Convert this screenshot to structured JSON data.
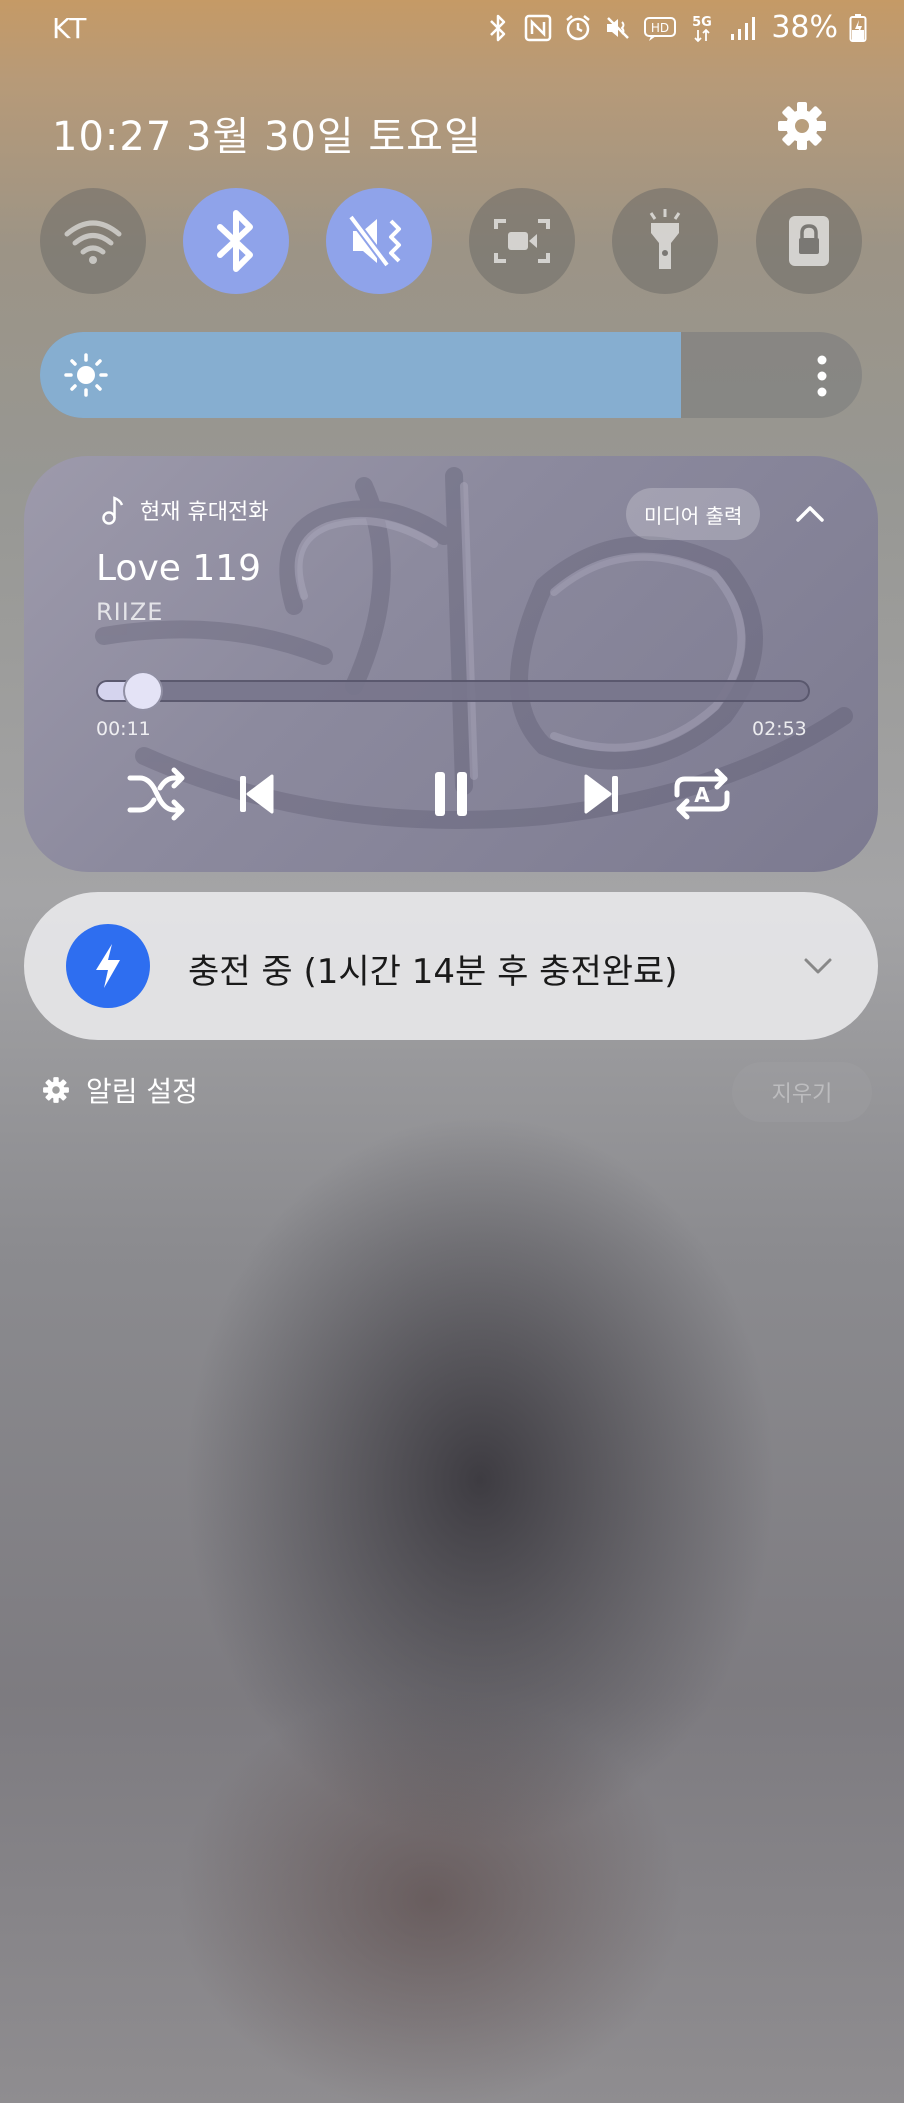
{
  "status_bar": {
    "carrier": "KT",
    "network": "5G",
    "hd_label": "HD",
    "battery": "38%",
    "icons": [
      "bluetooth-icon",
      "nfc-icon",
      "alarm-icon",
      "mute-icon",
      "volte-hd-icon",
      "5g-icon",
      "signal-icon",
      "battery-charging-icon"
    ]
  },
  "header": {
    "datetime": "10:27  3월 30일 토요일"
  },
  "quick_toggles": [
    {
      "name": "wifi",
      "icon": "wifi-icon",
      "state": "off"
    },
    {
      "name": "bluetooth",
      "icon": "bluetooth-icon",
      "state": "on"
    },
    {
      "name": "sound",
      "icon": "mute-vibrate-icon",
      "state": "on"
    },
    {
      "name": "screen-recorder",
      "icon": "screen-record-icon",
      "state": "off"
    },
    {
      "name": "flashlight",
      "icon": "flashlight-icon",
      "state": "off"
    },
    {
      "name": "secure-folder",
      "icon": "lock-icon",
      "state": "off"
    }
  ],
  "brightness": {
    "level": 0.78,
    "icon": "sun-icon"
  },
  "media": {
    "source": "현재 휴대전화",
    "output_button": "미디어 출력",
    "title": "Love 119",
    "artist": "RIIZE",
    "position": 0.063,
    "time_current": "00:11",
    "time_total": "02:53",
    "controls": [
      "shuffle-icon",
      "previous-icon",
      "pause-icon",
      "next-icon",
      "repeat-icon"
    ]
  },
  "charging": {
    "text": "충전 중 (1시간 14분 후 충전완료)",
    "accent": "#2e6ef0"
  },
  "footer": {
    "notification_settings": "알림 설정",
    "clear_all": "지우기"
  }
}
